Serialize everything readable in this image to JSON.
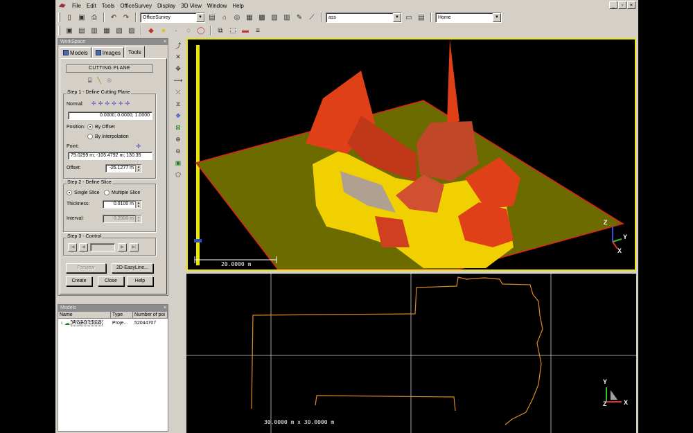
{
  "menu": {
    "items": [
      "File",
      "Edit",
      "Tools",
      "OfficeSurvey",
      "Display",
      "3D View",
      "Window",
      "Help"
    ]
  },
  "toolbar": {
    "project_combo": "OfficeSurvey",
    "layer_combo": "ass",
    "view_combo": "Home"
  },
  "workspace": {
    "title": "WorkSpace",
    "tabs": [
      "Models",
      "Images",
      "Tools"
    ],
    "active_tab": "Tools",
    "header": "CUTTING PLANE",
    "step1": {
      "title": "Step 1 - Define Cutting Plane",
      "normal_label": "Normal:",
      "normal_value": "0.0000; 0.0000; 1.0000",
      "position_label": "Position:",
      "by_offset": "By Offset",
      "by_interpolation": "By Interpolation",
      "point_label": "Point:",
      "point_value": "79.0299 m; -105.4792 m; 130.35",
      "offset_label": "Offset:",
      "offset_value": "-26.1277 m"
    },
    "step2": {
      "title": "Step 2 - Define Slice",
      "single_slice": "Single Slice",
      "multiple_slice": "Multiple Slice",
      "thickness_label": "Thickness:",
      "thickness_value": "0.0100 m",
      "interval_label": "Interval:",
      "interval_value": "0.2000 m"
    },
    "step3": {
      "title": "Step 3 - Control"
    },
    "buttons": {
      "preview": "Preview",
      "easyline": "2D-EasyLine...",
      "create": "Create",
      "close": "Close",
      "help": "Help"
    }
  },
  "models": {
    "title": "Models",
    "columns": [
      "Name",
      "Type",
      "Number of poi"
    ],
    "rows": [
      {
        "name": "Project Cloud",
        "type": "Proje...",
        "points": "52044707"
      }
    ]
  },
  "view3d": {
    "scale_label": "20.0000 m",
    "axes": {
      "z": "Z",
      "y": "Y",
      "x": "X"
    }
  },
  "view2d": {
    "scale_label": "30.0000 m x 30.0000 m",
    "axes": {
      "y": "Y",
      "z": "Z",
      "x": "X"
    }
  },
  "colors": {
    "window_bg": "#d4d0c8",
    "viewport_border": "#e8e800",
    "plane": "#6b6b00",
    "cloud_red": "#e04018",
    "cloud_yellow": "#f0d000",
    "section_line": "#e08a28"
  }
}
